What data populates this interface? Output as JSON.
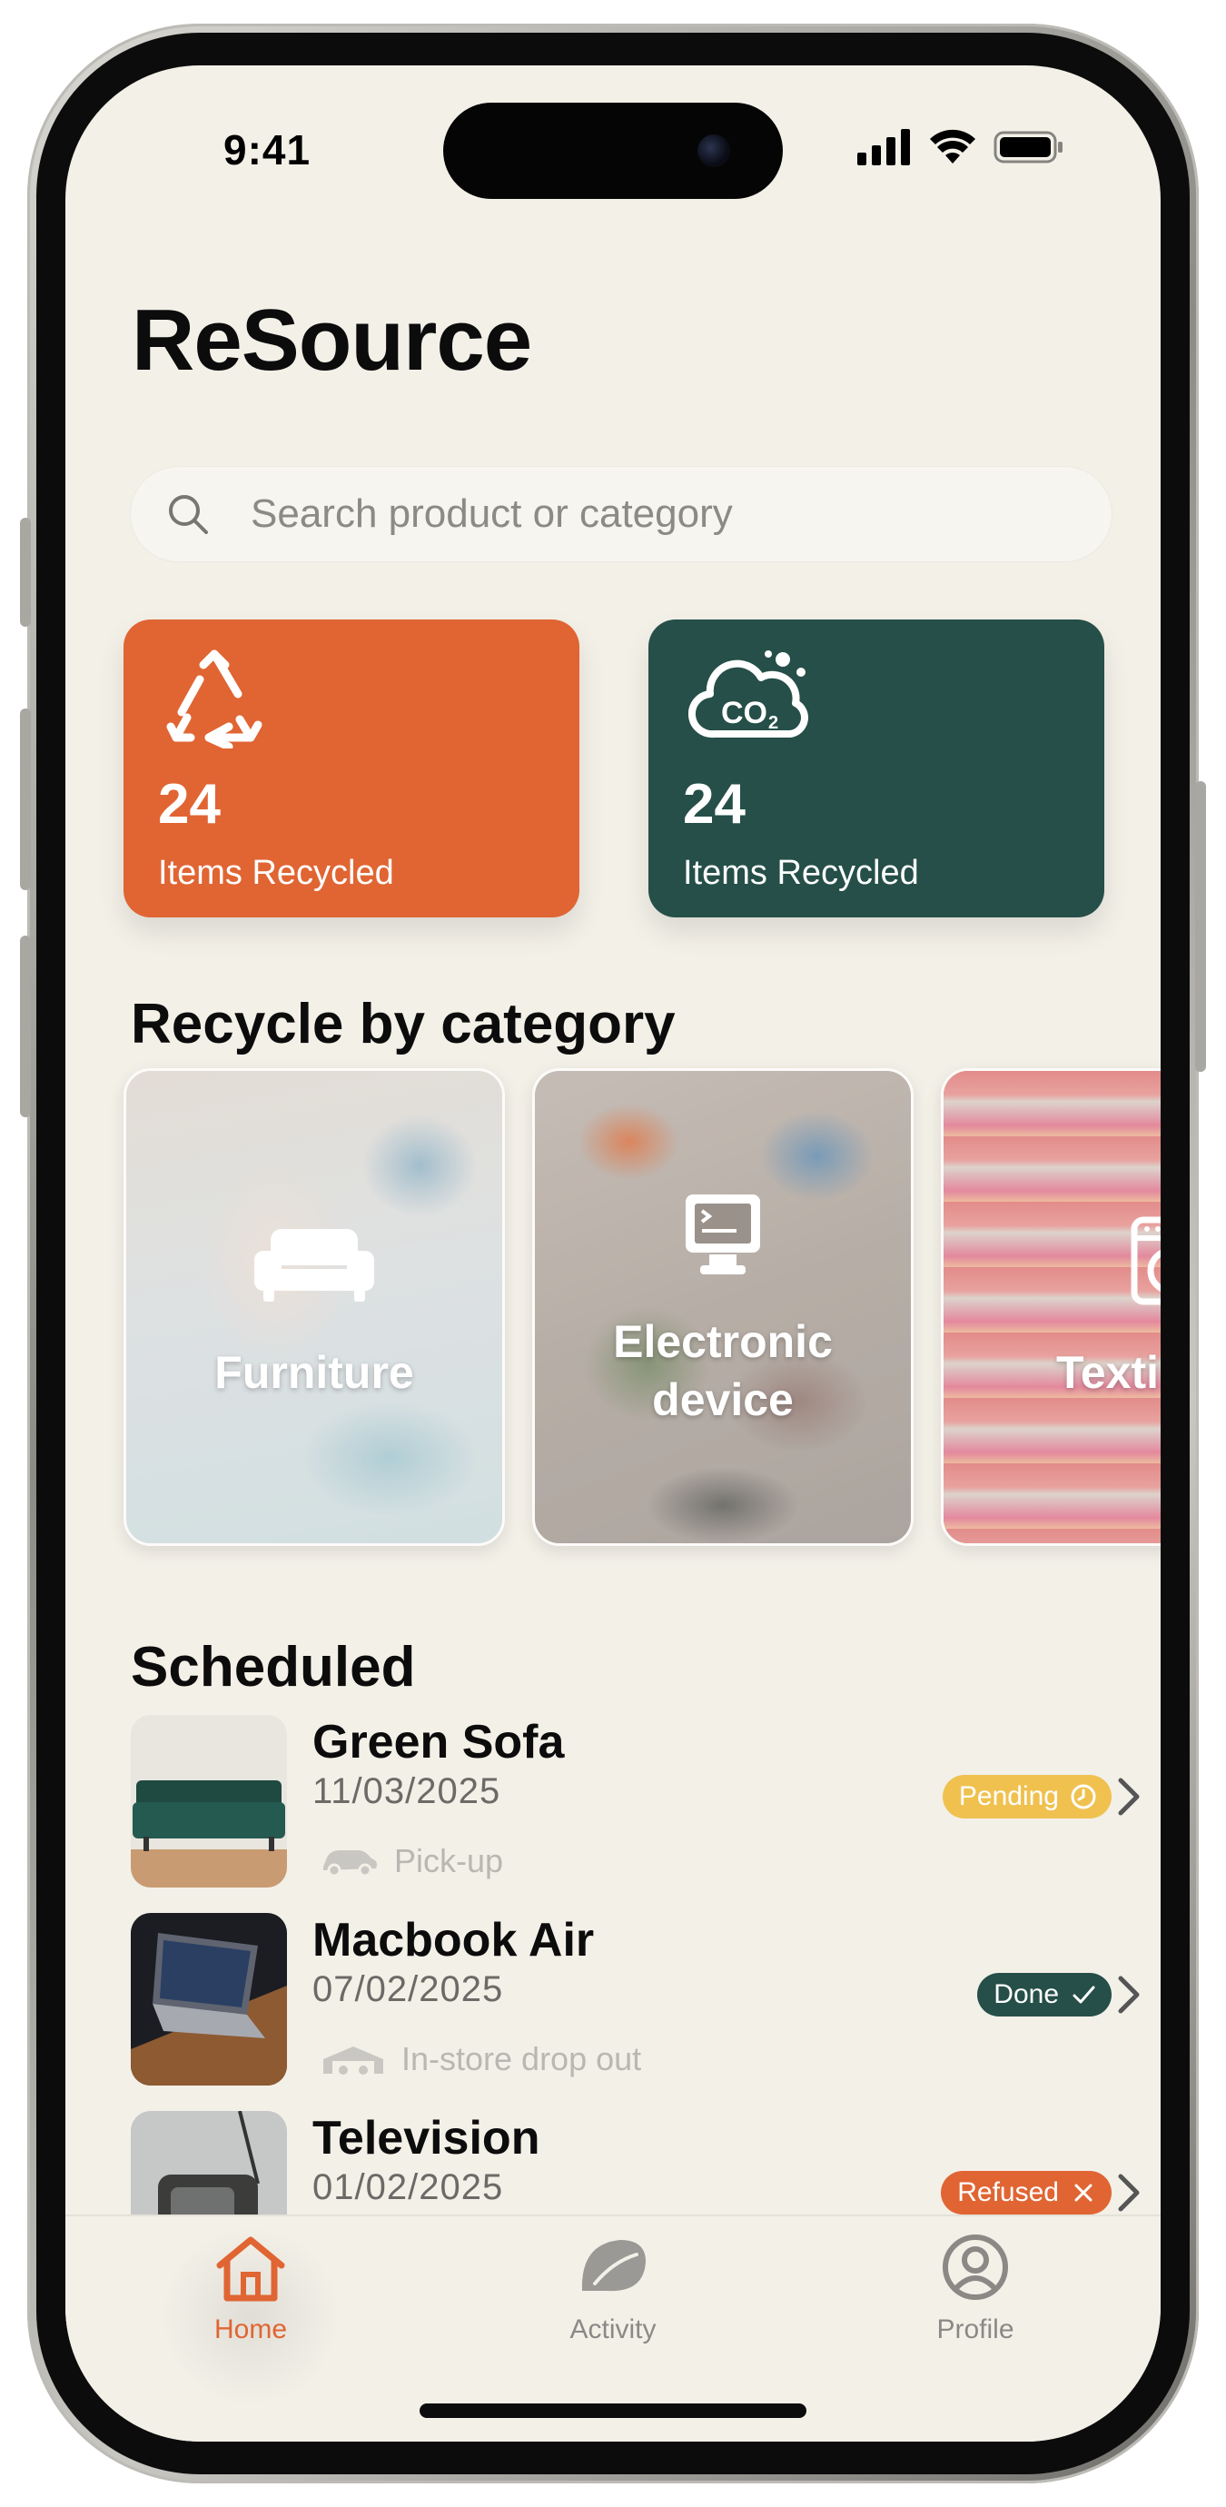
{
  "status_bar": {
    "time": "9:41"
  },
  "app": {
    "title": "ReSource"
  },
  "search": {
    "placeholder": "Search product or category"
  },
  "stats": [
    {
      "value": "24",
      "label": "Items Recycled",
      "icon": "recycle-icon",
      "color": "#e06533"
    },
    {
      "value": "24",
      "label": "Items Recycled",
      "icon": "co2-cloud-icon",
      "color": "#254f48"
    }
  ],
  "categories_section": {
    "title": "Recycle by category"
  },
  "categories": [
    {
      "label": "Furniture",
      "icon": "sofa-icon"
    },
    {
      "label": "Electronic device",
      "line1": "Electronic",
      "line2": "device",
      "icon": "computer-icon"
    },
    {
      "label": "Texti",
      "icon": "washing-machine-icon"
    }
  ],
  "scheduled_section": {
    "title": "Scheduled"
  },
  "scheduled": [
    {
      "name": "Green Sofa",
      "date": "11/03/2025",
      "method": "Pick-up",
      "method_icon": "car-icon",
      "status": "Pending",
      "status_icon": "clock-icon",
      "status_color": "#f0c14f"
    },
    {
      "name": "Macbook Air",
      "date": "07/02/2025",
      "method": "In-store drop out",
      "method_icon": "store-icon",
      "status": "Done",
      "status_icon": "check-icon",
      "status_color": "#254f48"
    },
    {
      "name": "Television",
      "date": "01/02/2025",
      "status": "Refused",
      "status_icon": "x-icon",
      "status_color": "#e06533"
    }
  ],
  "tabbar": {
    "tabs": [
      {
        "label": "Home",
        "icon": "home-icon",
        "active": true
      },
      {
        "label": "Activity",
        "icon": "leaf-icon",
        "active": false
      },
      {
        "label": "Profile",
        "icon": "profile-icon",
        "active": false
      }
    ]
  }
}
